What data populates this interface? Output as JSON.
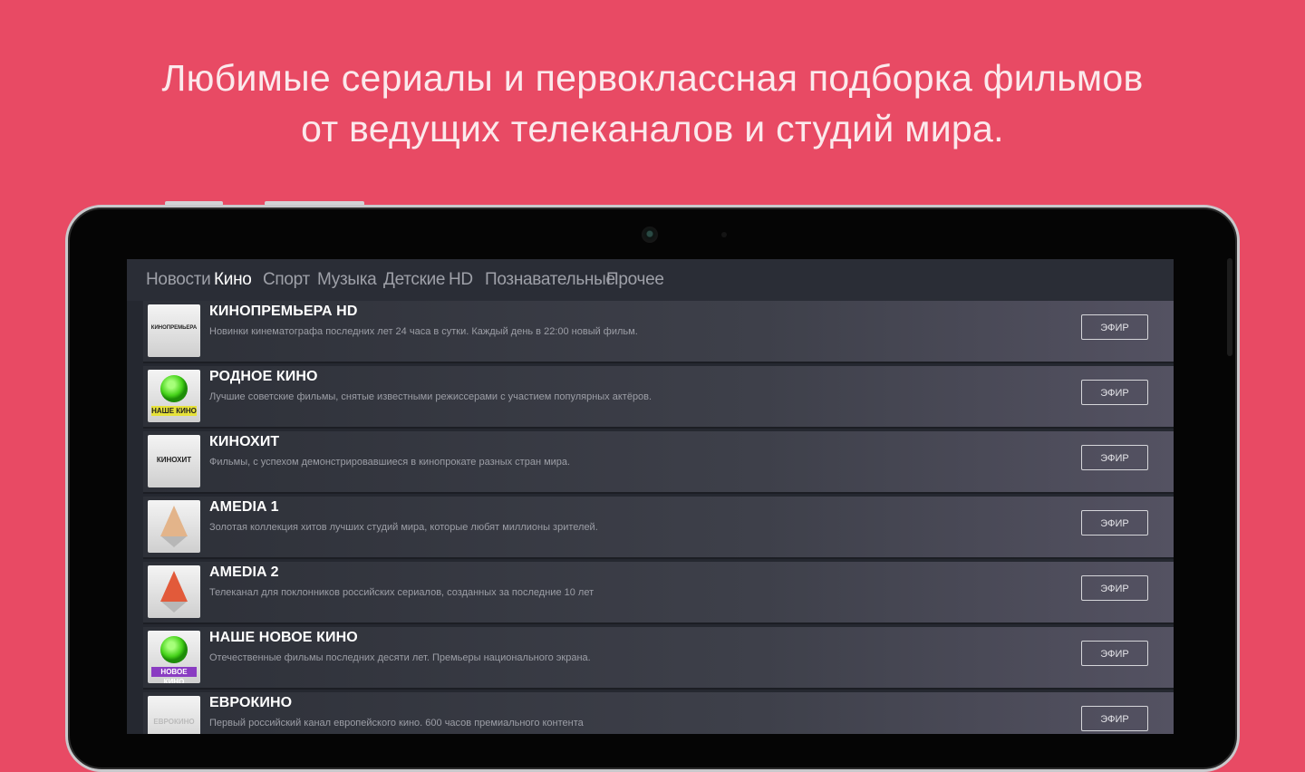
{
  "promo": {
    "line1": "Любимые сериалы и первоклассная подборка фильмов",
    "line2": "от ведущих телеканалов и студий мира."
  },
  "tabs": [
    {
      "label": "Новости",
      "active": false
    },
    {
      "label": "Кино",
      "active": true
    },
    {
      "label": "Спорт",
      "active": false
    },
    {
      "label": "Музыка",
      "active": false
    },
    {
      "label": "Детские",
      "active": false
    },
    {
      "label": "HD",
      "active": false
    },
    {
      "label": "Познавательные",
      "active": false
    },
    {
      "label": "Прочее",
      "active": false
    }
  ],
  "channels": [
    {
      "title": "КИНОПРЕМЬЕРА HD",
      "description": "Новинки кинематографа последних лет 24 часа в сутки. Каждый день в 22:00 новый фильм.",
      "logo_text": "КИНОПРЕМЬЕРА",
      "button": "ЭФИР"
    },
    {
      "title": "РОДНОЕ КИНО",
      "description": "Лучшие советские фильмы, снятые известными режиссерами с участием популярных актёров.",
      "logo_text": "НАШЕ КИНО",
      "button": "ЭФИР"
    },
    {
      "title": "КИНОХИТ",
      "description": "Фильмы, с успехом демонстрировавшиеся в кинопрокате разных стран мира.",
      "logo_text": "КИНОХИТ",
      "button": "ЭФИР"
    },
    {
      "title": "AMEDIA 1",
      "description": "Золотая коллекция хитов лучших студий мира, которые любят миллионы зрителей.",
      "logo_text": "",
      "button": "ЭФИР"
    },
    {
      "title": "AMEDIA 2",
      "description": "Телеканал для поклонников российских сериалов, созданных за последние 10 лет",
      "logo_text": "",
      "button": "ЭФИР"
    },
    {
      "title": "НАШЕ НОВОЕ КИНО",
      "description": "Отечественные фильмы последних десяти лет. Премьеры национального экрана.",
      "logo_text": "НОВОЕ КИНО",
      "button": "ЭФИР"
    },
    {
      "title": "ЕВРОКИНО",
      "description": "Первый российский канал европейского кино. 600 часов премиального контента",
      "logo_text": "ЕВРОКИНО",
      "button": "ЭФИР"
    }
  ],
  "colors": {
    "background": "#e84a64",
    "screen": "#252830",
    "tab_active": "#ffffff",
    "tab_inactive": "#9ea0a8"
  }
}
